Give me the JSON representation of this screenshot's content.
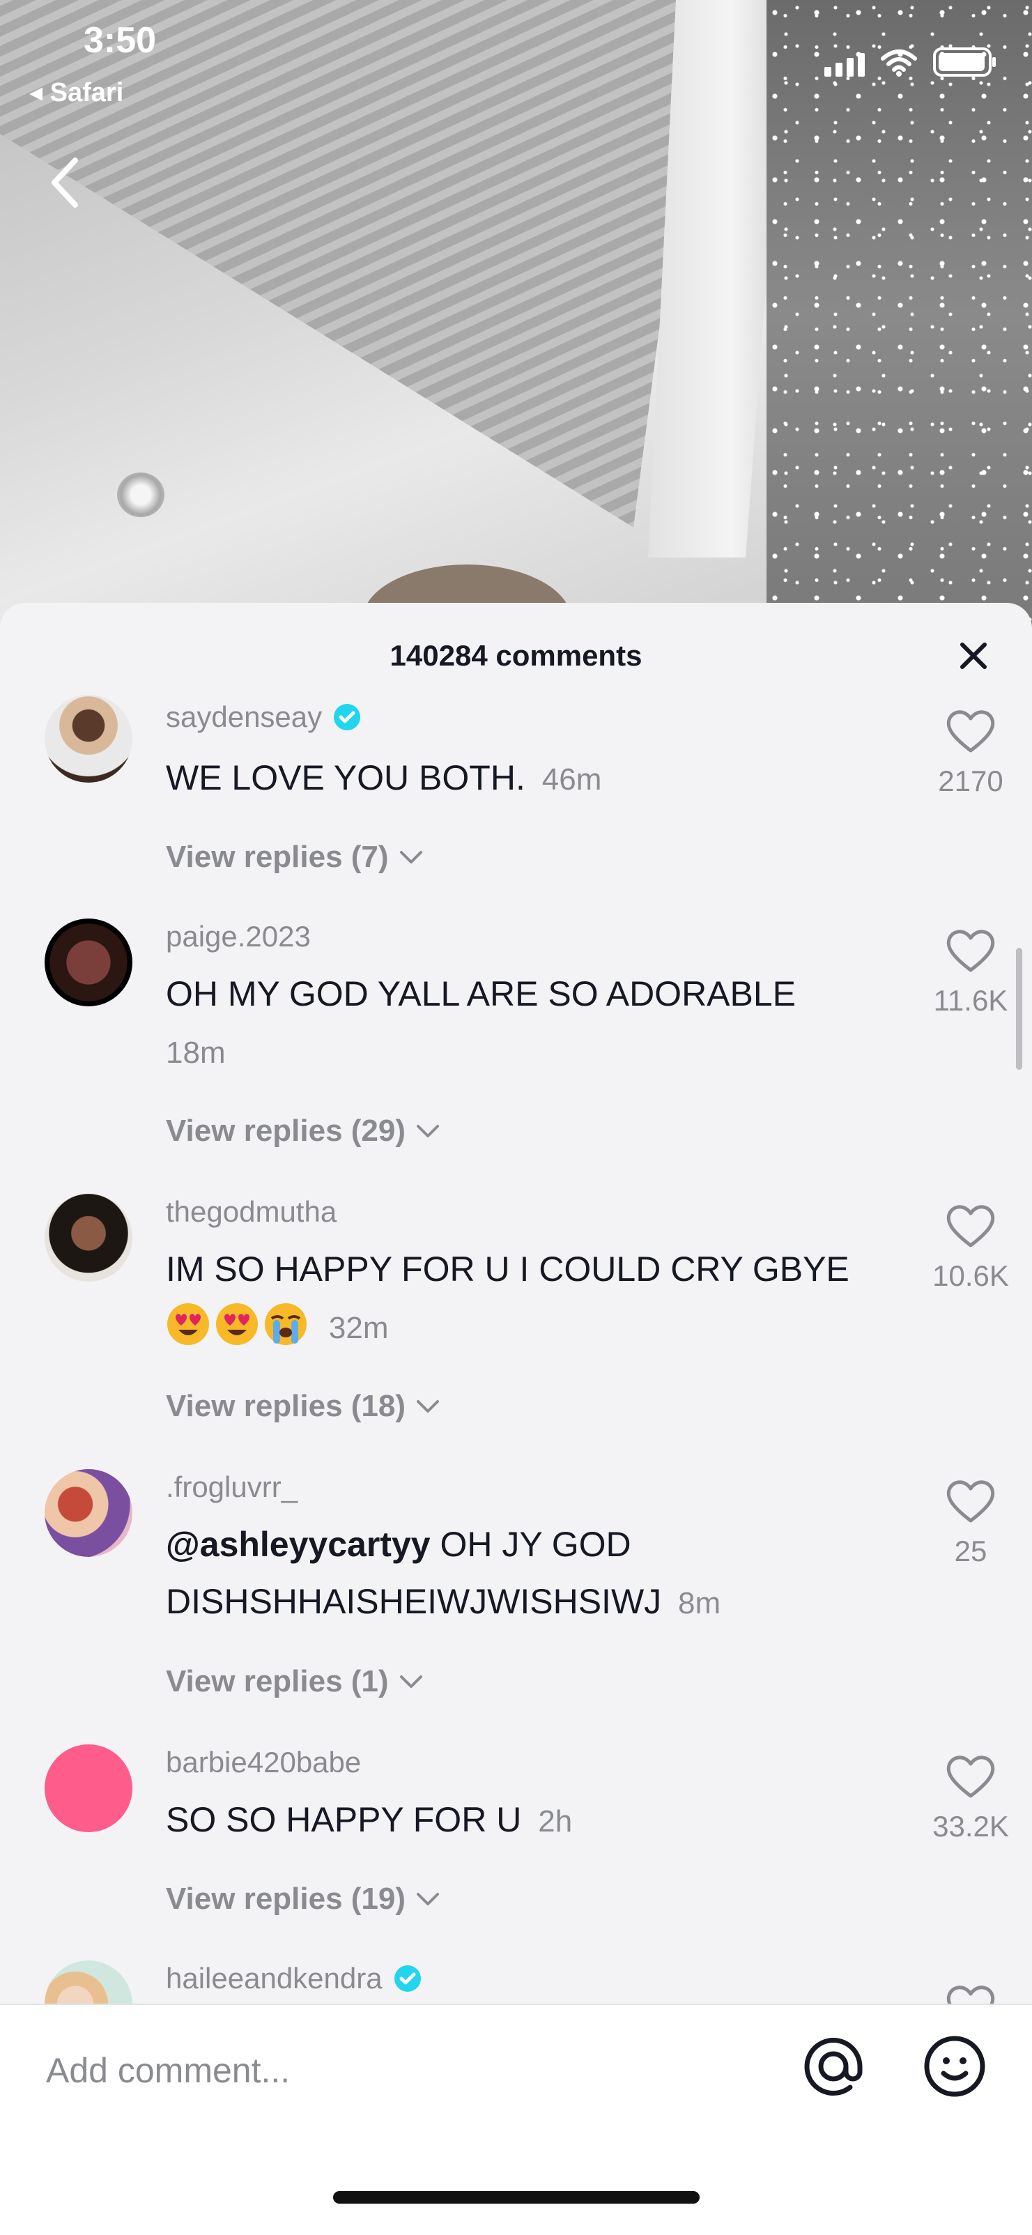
{
  "status_bar": {
    "time": "3:50",
    "back_app": "◂ Safari"
  },
  "header": {
    "comment_count": "140284 comments"
  },
  "comments": [
    {
      "username": "saydenseay",
      "verified": true,
      "text": "WE LOVE YOU BOTH.",
      "time": "46m",
      "view_replies": "View replies (7)",
      "likes": "2170"
    },
    {
      "username": "paige.2023",
      "verified": false,
      "text": "OH MY GOD YALL ARE SO ADORABLE",
      "time": "18m",
      "view_replies": "View replies (29)",
      "likes": "11.6K"
    },
    {
      "username": "thegodmutha",
      "verified": false,
      "text": "IM SO HAPPY FOR U I COULD CRY GBYE",
      "emojis": [
        "heart-eyes-emoji",
        "heart-eyes-emoji",
        "loudly-crying-emoji"
      ],
      "time": "32m",
      "view_replies": "View replies (18)",
      "likes": "10.6K"
    },
    {
      "username": ".frogluvrr_",
      "verified": false,
      "mention": "@ashleyycartyy",
      "text": "OH JY GOD DISHSHHAISHEIWJWISHSIWJ",
      "time": "8m",
      "view_replies": "View replies (1)",
      "likes": "25"
    },
    {
      "username": "barbie420babe",
      "verified": false,
      "text": "SO SO HAPPY FOR U",
      "time": "2h",
      "view_replies": "View replies (19)",
      "likes": "33.2K"
    },
    {
      "username": "haileeandkendra",
      "verified": true
    }
  ],
  "input": {
    "placeholder": "Add comment..."
  },
  "icons": {
    "back": "chevron-left-icon",
    "close": "close-icon",
    "like": "heart-icon",
    "verified": "verified-badge-icon",
    "mention": "at-sign-icon",
    "emoji": "smiley-icon"
  },
  "colors": {
    "verified_badge": "#20d5ec",
    "text_primary": "#161823",
    "text_secondary": "#8a8b91",
    "sheet_bg": "#f3f3f5"
  }
}
